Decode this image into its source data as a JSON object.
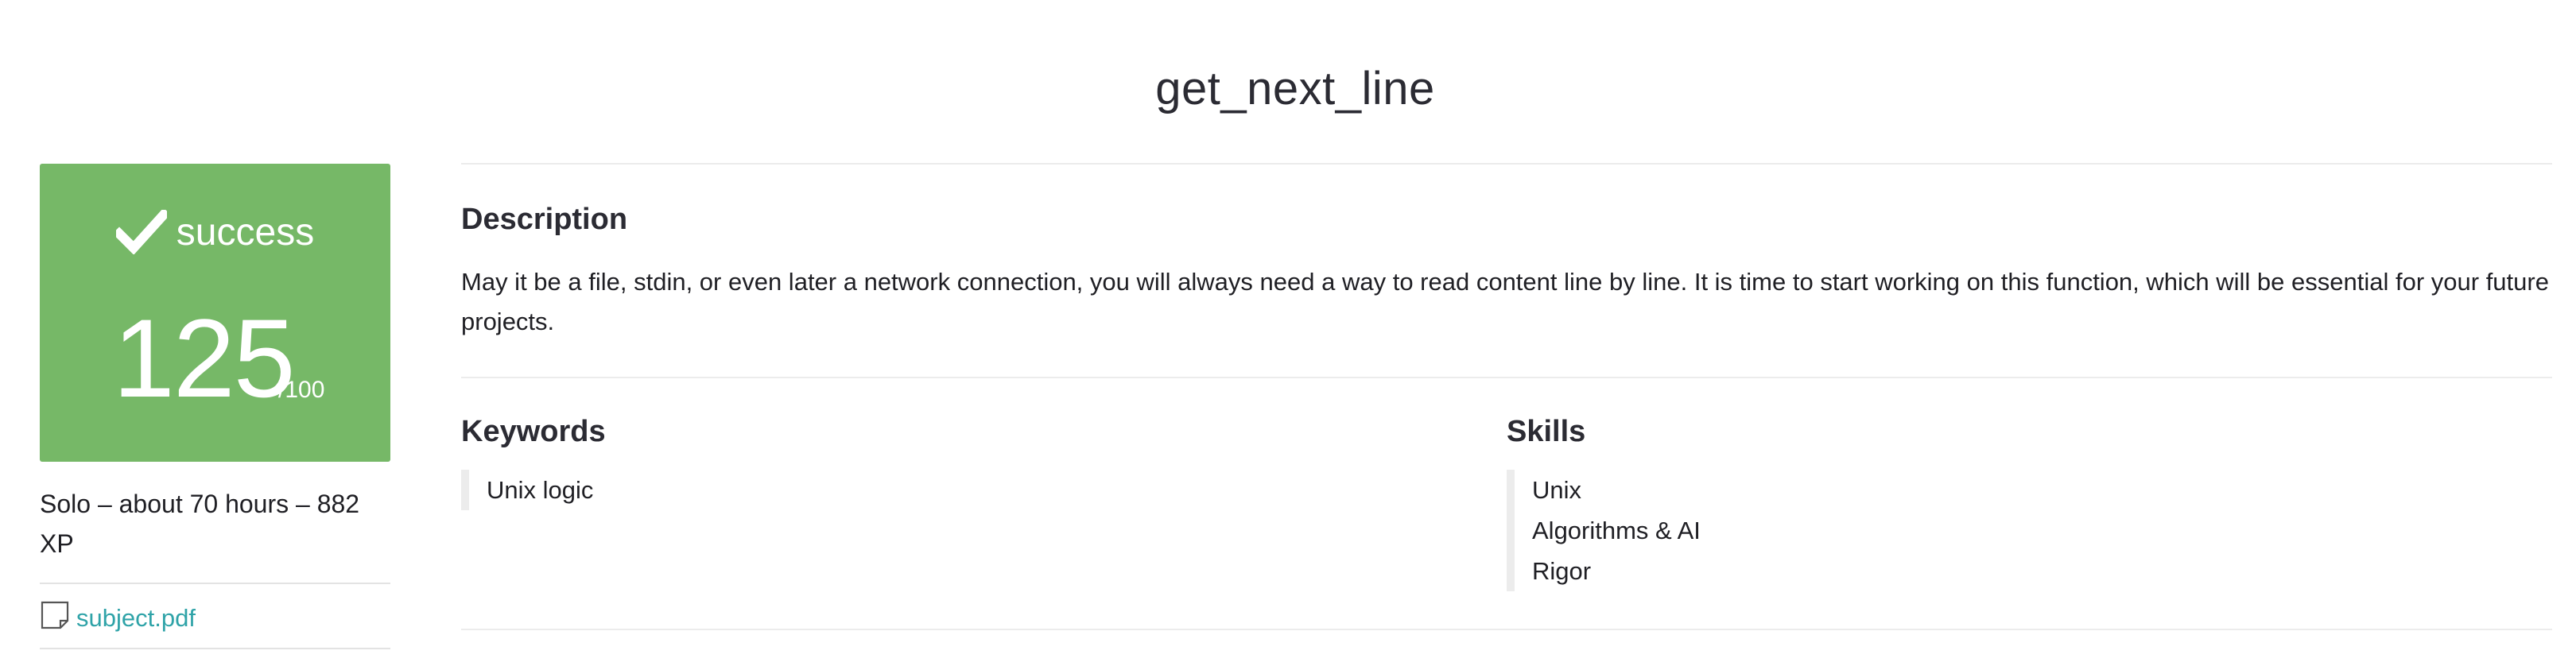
{
  "project": {
    "title": "get_next_line"
  },
  "grade": {
    "status": "success",
    "score": "125",
    "max": "/100",
    "color": "#76b867"
  },
  "meta": {
    "summary": "Solo – about 70 hours – 882 XP",
    "attachment_label": "subject.pdf",
    "attachment_icon": "document-icon"
  },
  "description": {
    "heading": "Description",
    "text": "May it be a file, stdin, or even later a network connection, you will always need a way to read content line by line. It is time to start working on this function, which will be essential for your future projects."
  },
  "keywords": {
    "heading": "Keywords",
    "items": [
      "Unix logic"
    ]
  },
  "skills": {
    "heading": "Skills",
    "items": [
      "Unix",
      "Algorithms & AI",
      "Rigor"
    ]
  },
  "colors": {
    "link": "#2fa3a8",
    "success": "#76b867"
  }
}
